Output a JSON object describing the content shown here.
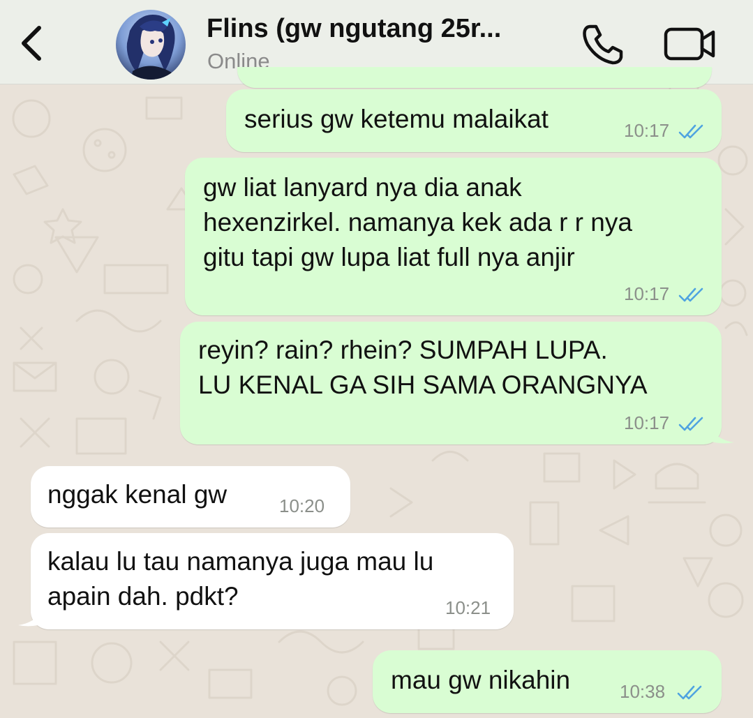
{
  "header": {
    "contact_name": "Flins (gw ngutang 25r...",
    "status": "Online"
  },
  "icons": {
    "back": "chevron-left-icon",
    "call": "phone-icon",
    "video": "video-camera-icon",
    "read_receipt": "double-check-icon"
  },
  "colors": {
    "outgoing_bubble": "#d9fdd3",
    "incoming_bubble": "#ffffff",
    "read_tick": "#4fa3e0",
    "header_bg": "#ecefe9",
    "wallpaper": "#e9e2d9"
  },
  "messages": [
    {
      "direction": "out",
      "text": "serius gw ketemu malaikat",
      "time": "10:17",
      "read": true
    },
    {
      "direction": "out",
      "text": "gw liat lanyard nya dia anak\nhexenzirkel. namanya kek ada r r nya\ngitu tapi gw lupa liat full nya anjir",
      "time": "10:17",
      "read": true
    },
    {
      "direction": "out",
      "text": "reyin? rain? rhein? SUMPAH LUPA.\nLU KENAL GA SIH SAMA ORANGNYA",
      "time": "10:17",
      "read": true
    },
    {
      "direction": "in",
      "text": "nggak kenal gw",
      "time": "10:20"
    },
    {
      "direction": "in",
      "text": "kalau lu tau namanya juga mau lu\napain dah. pdkt?",
      "time": "10:21"
    },
    {
      "direction": "out",
      "text": "mau gw nikahin",
      "time": "10:38",
      "read": true
    }
  ]
}
